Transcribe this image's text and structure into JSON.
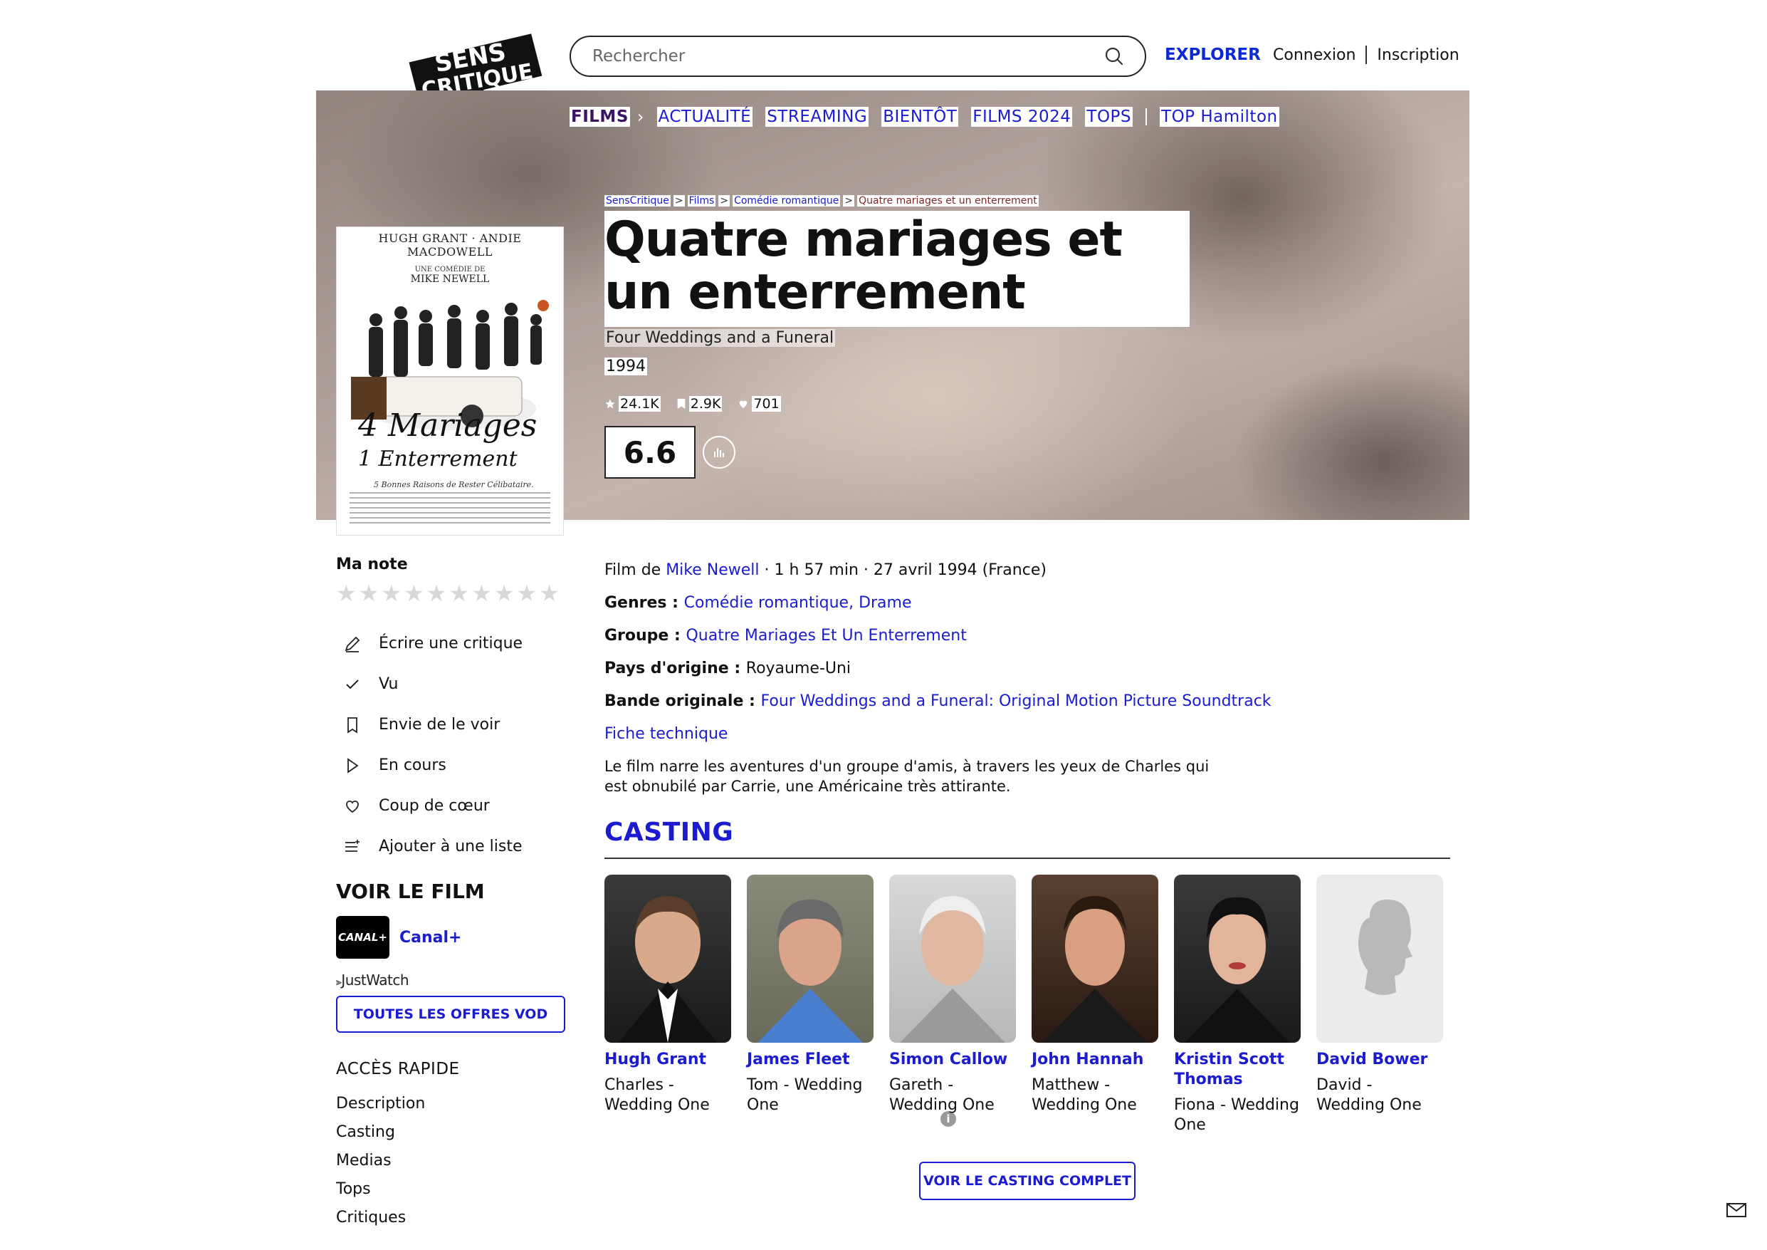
{
  "header": {
    "logo_text": "SENS CRITIQUE",
    "search_placeholder": "Rechercher",
    "explorer_label": "EXPLORER",
    "login_label": "Connexion",
    "signup_label": "Inscription"
  },
  "nav": {
    "items": [
      "FILMS",
      "ACTUALITÉ",
      "STREAMING",
      "BIENTÔT",
      "FILMS 2024",
      "TOPS",
      "TOP Hamilton"
    ]
  },
  "breadcrumb": [
    "SensCritique",
    "Films",
    "Comédie romantique",
    "Quatre mariages et un enterrement"
  ],
  "movie": {
    "title": "Quatre mariages et un enterrement",
    "original_title": "Four Weddings and a Funeral",
    "year": "1994",
    "ratings_count": "24.1K",
    "wishlist_count": "2.9K",
    "favorites_count": "701",
    "score": "6.6"
  },
  "poster": {
    "credits_line": "HUGH GRANT · ANDIE MACDOWELL",
    "subtitle_line": "UNE COMÉDIE DE",
    "director_line": "MIKE NEWELL",
    "title_line1": "4 Mariages",
    "title_line2": "1 Enterrement",
    "tagline": "5 Bonnes Raisons de Rester Célibataire."
  },
  "sidebar": {
    "my_rating_label": "Ma note",
    "actions": [
      {
        "label": "Écrire une critique",
        "icon": "pencil-icon"
      },
      {
        "label": "Vu",
        "icon": "check-icon"
      },
      {
        "label": "Envie de le voir",
        "icon": "bookmark-icon"
      },
      {
        "label": "En cours",
        "icon": "play-icon"
      },
      {
        "label": "Coup de cœur",
        "icon": "heart-icon"
      },
      {
        "label": "Ajouter à une liste",
        "icon": "list-icon"
      }
    ],
    "watch_title": "VOIR LE FILM",
    "provider_badge": "CANAL+",
    "provider_name": "Canal+",
    "justwatch": "JustWatch",
    "vod_button": "TOUTES LES OFFRES VOD",
    "quick_access_title": "ACCÈS RAPIDE",
    "quick_links": [
      "Description",
      "Casting",
      "Medias",
      "Tops",
      "Critiques"
    ]
  },
  "details": {
    "film_by_prefix": "Film de ",
    "director": "Mike Newell",
    "runtime_release": " · 1 h 57 min · 27 avril 1994 (France)",
    "genres_label": "Genres : ",
    "genres": "Comédie romantique, Drame",
    "group_label": "Groupe : ",
    "group": "Quatre Mariages Et Un Enterrement",
    "country_label": "Pays d'origine : ",
    "country": "Royaume-Uni",
    "soundtrack_label": "Bande originale : ",
    "soundtrack": "Four Weddings and a Funeral: Original Motion Picture Soundtrack",
    "tech_sheet": "Fiche technique",
    "synopsis": "Le film narre les aventures d'un groupe d'amis, à travers les yeux de Charles qui est obnubilé par Carrie, une Américaine très attirante."
  },
  "casting": {
    "title": "CASTING",
    "actors": [
      {
        "name": "Hugh Grant",
        "role": "Charles - Wedding One"
      },
      {
        "name": "James Fleet",
        "role": "Tom - Wedding One"
      },
      {
        "name": "Simon Callow",
        "role": "Gareth - Wedding One"
      },
      {
        "name": "John Hannah",
        "role": "Matthew - Wedding One"
      },
      {
        "name": "Kristin Scott Thomas",
        "role": "Fiona - Wedding One"
      },
      {
        "name": "David Bower",
        "role": "David - Wedding One"
      }
    ],
    "full_button": "VOIR LE CASTING COMPLET"
  },
  "colors": {
    "accent": "#1b1bd0",
    "text": "#111111"
  }
}
